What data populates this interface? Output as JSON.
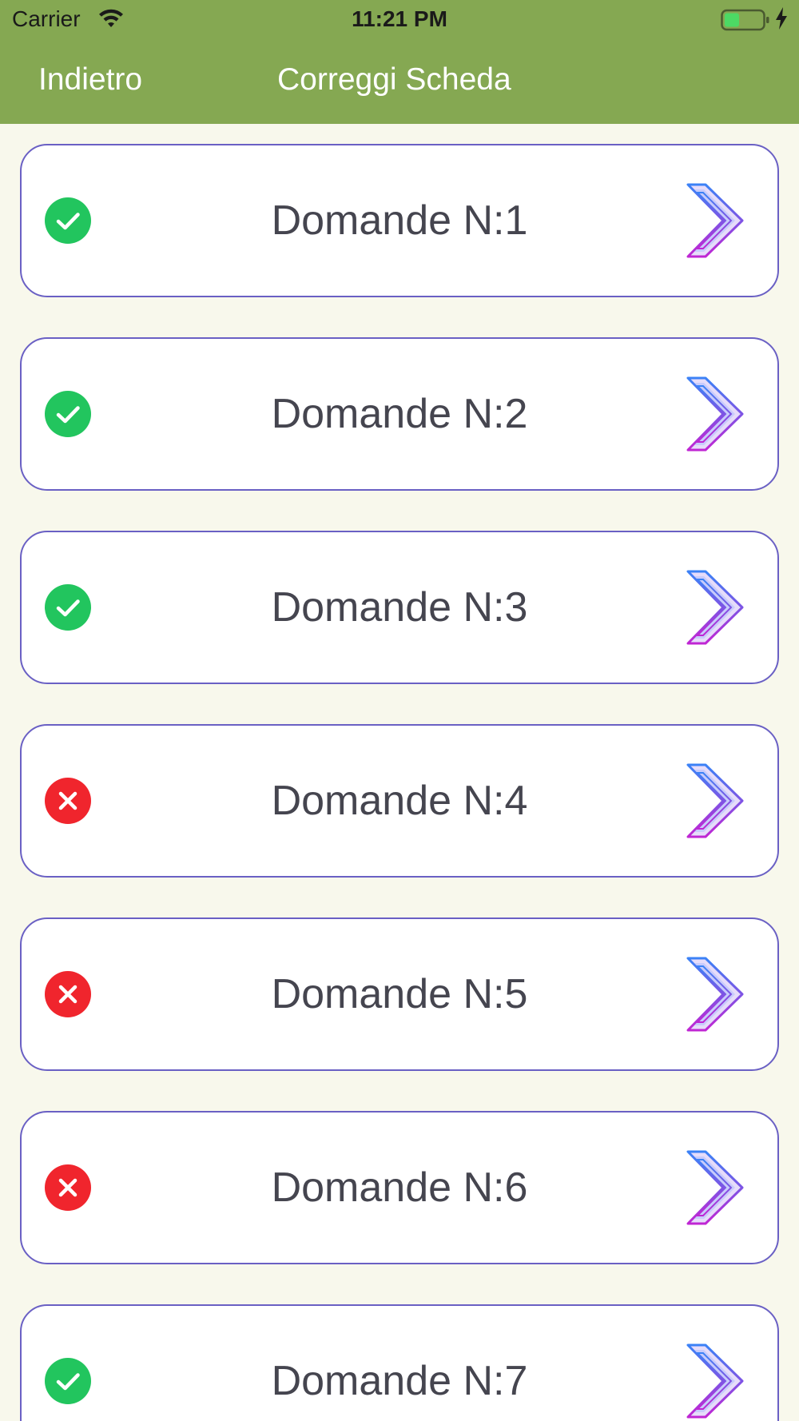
{
  "status_bar": {
    "carrier": "Carrier",
    "time": "11:21 PM",
    "icons": [
      "wifi-icon",
      "battery-icon",
      "charging-bolt-icon"
    ]
  },
  "nav": {
    "back_label": "Indietro",
    "title": "Correggi Scheda"
  },
  "colors": {
    "nav_background": "#85a852",
    "page_background": "#f8f8ec",
    "row_border": "#6a60c4",
    "correct": "#22c55e",
    "wrong": "#f0252d",
    "label_text": "#45454f"
  },
  "questions": [
    {
      "label": "Domande N:1",
      "status": "correct",
      "icon": "checkmark-circle-icon"
    },
    {
      "label": "Domande N:2",
      "status": "correct",
      "icon": "checkmark-circle-icon"
    },
    {
      "label": "Domande N:3",
      "status": "correct",
      "icon": "checkmark-circle-icon"
    },
    {
      "label": "Domande N:4",
      "status": "wrong",
      "icon": "cross-circle-icon"
    },
    {
      "label": "Domande N:5",
      "status": "wrong",
      "icon": "cross-circle-icon"
    },
    {
      "label": "Domande N:6",
      "status": "wrong",
      "icon": "cross-circle-icon"
    },
    {
      "label": "Domande N:7",
      "status": "correct",
      "icon": "checkmark-circle-icon"
    }
  ]
}
